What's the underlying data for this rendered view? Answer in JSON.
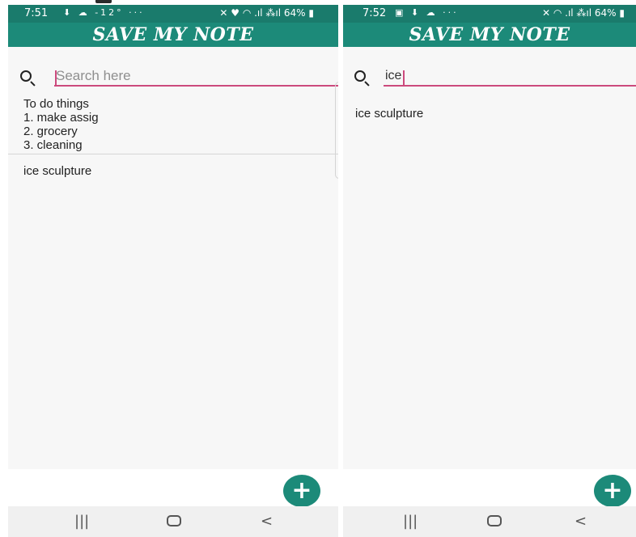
{
  "screens": [
    {
      "status": {
        "time": "7:51",
        "left_icons": "⬇ ☁ -12° ···",
        "right_text": "✕ ♥ ◠ .ıl ⁂ıl 64% ▮"
      },
      "app_title": "SAVE MY NOTE",
      "search": {
        "value": "",
        "placeholder": "Search here"
      },
      "notes": [
        {
          "lines": [
            "To do things",
            "1. make assig",
            "2. grocery",
            "3. cleaning"
          ]
        },
        {
          "lines": [
            "ice sculpture"
          ]
        }
      ],
      "fab_label": "+",
      "nav": {
        "recents": "|||",
        "back": "<"
      }
    },
    {
      "status": {
        "time": "7:52",
        "left_icons": "▣ ⬇ ☁ ···",
        "right_text": "✕ ◠ .ıl ⁂ıl 64% ▮"
      },
      "app_title": "SAVE MY NOTE",
      "search": {
        "value": "ice",
        "placeholder": "Search here"
      },
      "notes": [
        {
          "lines": [
            "ice sculpture"
          ]
        }
      ],
      "fab_label": "+",
      "nav": {
        "recents": "|||",
        "back": "<"
      }
    }
  ],
  "colors": {
    "status_bar": "#1a7b6c",
    "app_bar": "#1c8a79",
    "accent_underline": "#cc4a7d",
    "fab": "#1c8a79"
  },
  "icons": [
    "search-icon",
    "add-icon",
    "recents-icon",
    "home-icon",
    "back-icon"
  ]
}
